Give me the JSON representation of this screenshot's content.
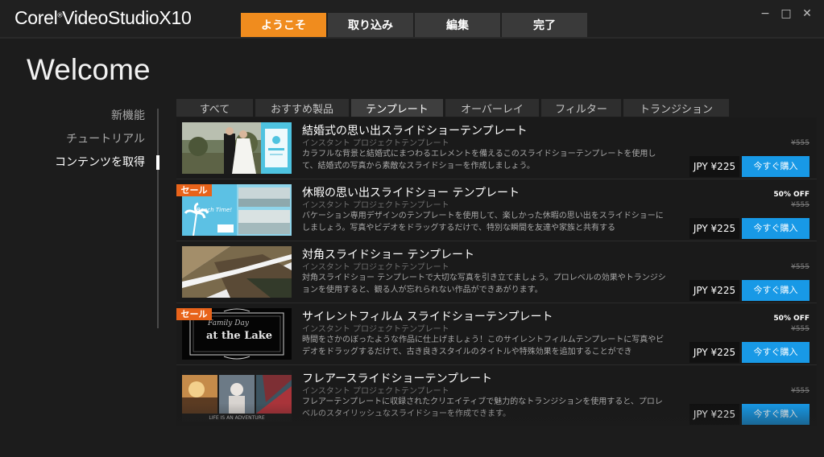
{
  "app": {
    "logo_corel": "Corel",
    "logo_product": "VideoStudio",
    "logo_version": "X10",
    "tabs": [
      "ようこそ",
      "取り込み",
      "編集",
      "完了"
    ],
    "active_tab": 0,
    "window_controls": {
      "minimize": "−",
      "maximize": "□",
      "close": "✕"
    }
  },
  "page": {
    "title": "Welcome"
  },
  "sidebar": {
    "items": [
      {
        "label": "新機能"
      },
      {
        "label": "チュートリアル"
      },
      {
        "label": "コンテンツを取得"
      }
    ],
    "active_index": 2
  },
  "filter_tabs": {
    "items": [
      "すべて",
      "おすすめ製品",
      "テンプレート",
      "オーバーレイ",
      "フィルター",
      "トランジション"
    ],
    "active_index": 2
  },
  "products": [
    {
      "title": "結婚式の思い出スライドショーテンプレート",
      "subtitle": "インスタント プロジェクトテンプレート",
      "description": "カラフルな背景と結婚式にまつわるエレメントを備えるこのスライドショーテンプレートを使用して、結婚式の写真から素敵なスライドショーを作成しましょう。",
      "sale": false,
      "discount": "",
      "original_price": "¥555",
      "price": "JPY ¥225",
      "buy_label": "今すぐ購入",
      "thumb": "wedding"
    },
    {
      "title": "休暇の思い出スライドショー テンプレート",
      "subtitle": "インスタント プロジェクトテンプレート",
      "description": "バケーション専用デザインのテンプレートを使用して、楽しかった休暇の思い出をスライドショーにしましょう。写真やビデオをドラッグするだけで、特別な瞬間を友達や家族と共有する",
      "sale": true,
      "sale_label": "セール",
      "discount": "50% OFF",
      "original_price": "¥555",
      "price": "JPY ¥225",
      "buy_label": "今すぐ購入",
      "thumb_caption": "Beach Time!",
      "thumb": "beach"
    },
    {
      "title": "対角スライドショー テンプレート",
      "subtitle": "インスタント プロジェクトテンプレート",
      "description": "対角スライドショー テンプレートで大切な写真を引き立てましょう。プロレベルの効果やトランジションを使用すると、観る人が忘れられない作品ができあがります。",
      "sale": false,
      "discount": "",
      "original_price": "¥555",
      "price": "JPY ¥225",
      "buy_label": "今すぐ購入",
      "thumb": "diagonal"
    },
    {
      "title": "サイレントフィルム スライドショーテンプレート",
      "subtitle": "インスタント プロジェクトテンプレート",
      "description": "時間をさかのぼったような作品に仕上げましょう！このサイレントフィルムテンプレートに写真やビデオをドラッグするだけで、古き良きスタイルのタイトルや特殊効果を追加することができ",
      "sale": true,
      "sale_label": "セール",
      "discount": "50% OFF",
      "original_price": "¥555",
      "price": "JPY ¥225",
      "buy_label": "今すぐ購入",
      "thumb_caption_1": "Family Day",
      "thumb_caption_2": "at the Lake",
      "thumb": "silent"
    },
    {
      "title": "フレアースライドショーテンプレート",
      "subtitle": "インスタント プロジェクトテンプレート",
      "description": "フレアーテンプレートに収録されたクリエイティブで魅力的なトランジションを使用すると、プロレベルのスタイリッシュなスライドショーを作成できます。",
      "sale": false,
      "discount": "",
      "original_price": "¥555",
      "price": "JPY ¥225",
      "buy_label": "今すぐ購入",
      "thumb_caption": "LIFE IS AN ADVENTURE",
      "thumb": "flare"
    }
  ]
}
